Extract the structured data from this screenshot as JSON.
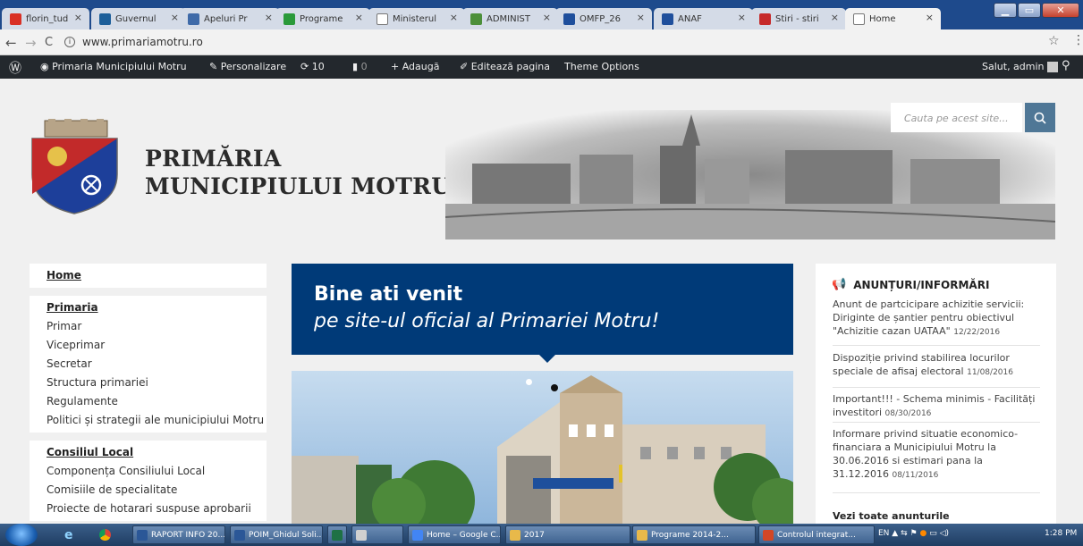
{
  "browser": {
    "tabs": [
      {
        "label": "florin_tud",
        "icon": "gmail-icon",
        "color": "#d93025"
      },
      {
        "label": "Guvernul",
        "icon": "guvernul-icon",
        "color": "#1d5f9a"
      },
      {
        "label": "Apeluri Pr",
        "icon": "apeluri-icon",
        "color": "#3f6aa8"
      },
      {
        "label": "Programe",
        "icon": "programe-icon",
        "color": "#2a9a3a"
      },
      {
        "label": "Ministerul",
        "icon": "page-icon",
        "color": "#ffffff"
      },
      {
        "label": "ADMINIST",
        "icon": "admin-icon",
        "color": "#4c8f3a"
      },
      {
        "label": "OMFP_26",
        "icon": "shield-icon",
        "color": "#1f4f9c"
      },
      {
        "label": "ANAF",
        "icon": "shield-icon",
        "color": "#1f4f9c"
      },
      {
        "label": "Stiri - stiri",
        "icon": "stiri-icon",
        "color": "#c62a2a"
      },
      {
        "label": "Home",
        "icon": "page-icon",
        "color": "#ffffff"
      }
    ],
    "url": "www.primariamotru.ro"
  },
  "admin_bar": {
    "site_name": "Primaria Municipiului Motru",
    "customize": "Personalizare",
    "updates": "10",
    "comments": "0",
    "add": "Adaugă",
    "edit": "Editează pagina",
    "theme": "Theme Options",
    "greeting": "Salut, admin"
  },
  "header": {
    "title_line1": "PRIMĂRIA",
    "title_line2": "MUNICIPIULUI MOTRU",
    "search_placeholder": "Cauta pe acest site..."
  },
  "left_nav": {
    "groups": [
      {
        "items": [
          "Home"
        ]
      },
      {
        "items": [
          "Primaria",
          "Primar",
          "Viceprimar",
          "Secretar",
          "Structura primariei",
          "Regulamente",
          "Politici și strategii ale municipiului Motru"
        ]
      },
      {
        "items": [
          "Consiliul Local",
          "Componența Consiliului Local",
          "Comisiile de specialitate",
          "Proiecte de hotarari suspuse aprobarii"
        ]
      }
    ]
  },
  "welcome": {
    "title": "Bine ati venit",
    "subtitle": "pe site-ul oficial al Primariei Motru!"
  },
  "announcements": {
    "heading": "ANUNȚURI/INFORMĂRI",
    "items": [
      {
        "text": "Anunt de partcicipare achizitie servicii: Diriginte de șantier pentru obiectivul \"Achizitie cazan UATAA\"",
        "date": "12/22/2016"
      },
      {
        "text": "Dispoziție privind stabilirea locurilor speciale de afisaj electoral",
        "date": "11/08/2016"
      },
      {
        "text": "Important!!! - Schema minimis - Facilități investitori",
        "date": "08/30/2016"
      },
      {
        "text": "Informare privind situatie economico-financiara a Municipiului Motru la 30.06.2016 si estimari pana la 31.12.2016",
        "date": "08/11/2016"
      }
    ],
    "see_all": "Vezi toate anunturile"
  },
  "taskbar": {
    "tasks": [
      {
        "label": "RAPORT INFO 20...",
        "icon": "word-icon",
        "color": "#2b5797"
      },
      {
        "label": "POIM_Ghidul Soli...",
        "icon": "word-icon",
        "color": "#2b5797"
      },
      {
        "label": "",
        "icon": "excel-icon",
        "color": "#1e7145"
      },
      {
        "label": "",
        "icon": "app-icon",
        "color": "#d0d0d0"
      },
      {
        "label": "Home – Google C...",
        "icon": "chrome-icon",
        "color": "#4285f4"
      },
      {
        "label": "2017",
        "icon": "folder-icon",
        "color": "#e8b94a"
      },
      {
        "label": "Programe 2014-2...",
        "icon": "folder-icon",
        "color": "#e8b94a"
      },
      {
        "label": "Controlul integrat...",
        "icon": "ppt-icon",
        "color": "#d24726"
      }
    ],
    "language": "EN",
    "time": "1:28 PM"
  }
}
